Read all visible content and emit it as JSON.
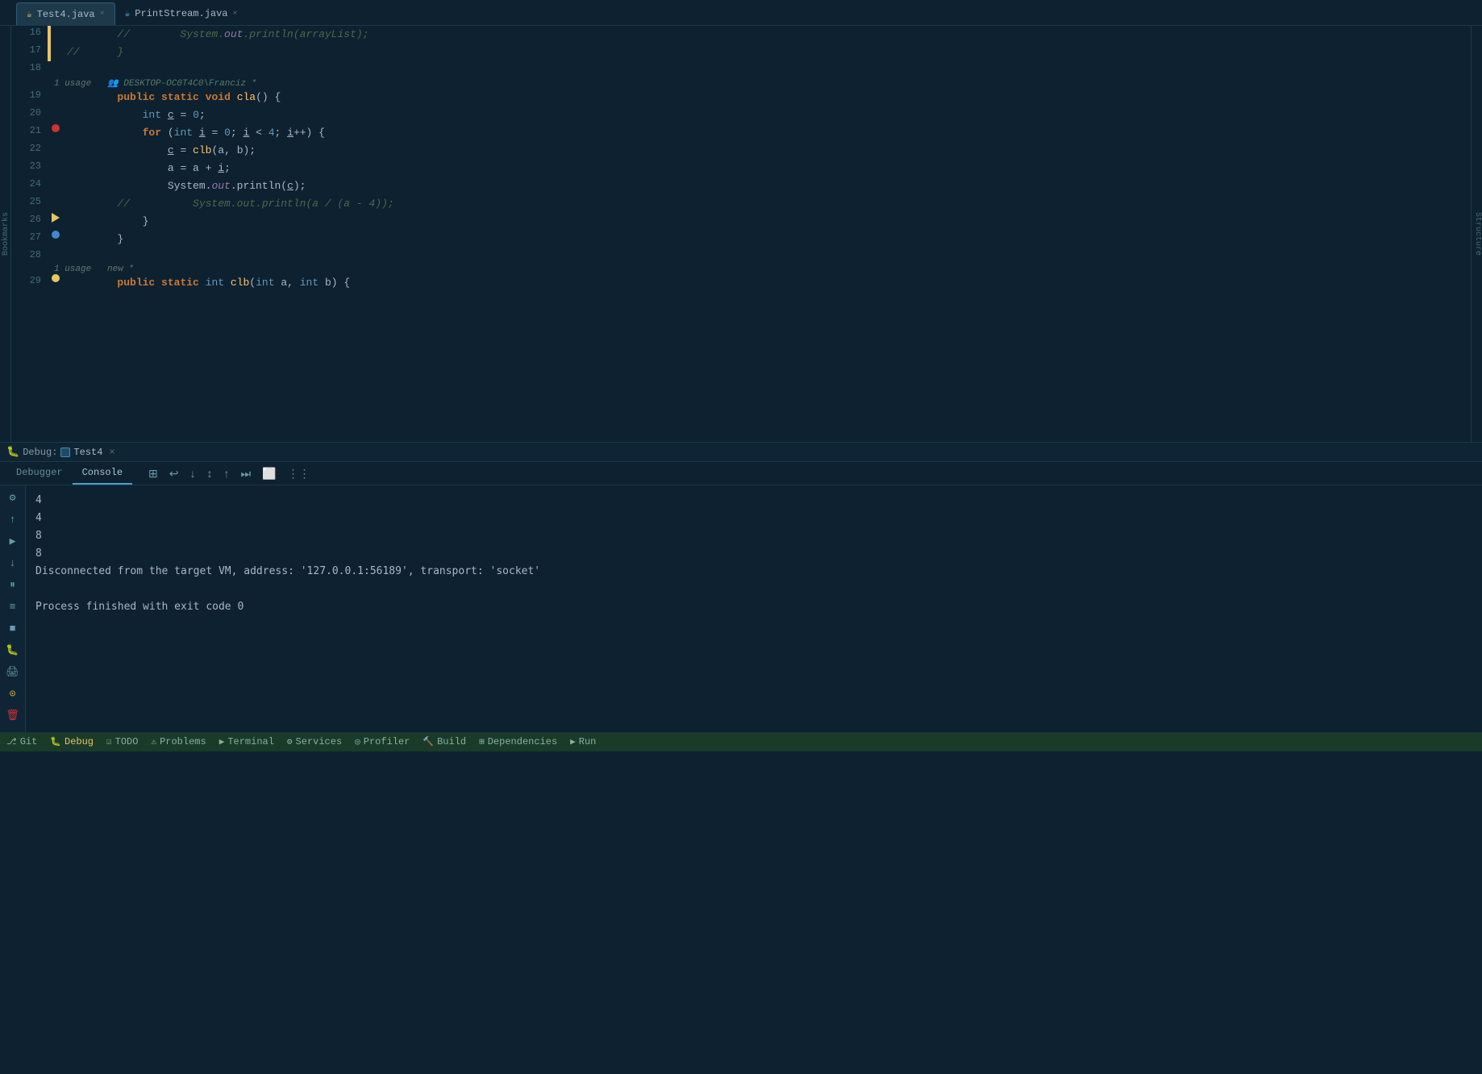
{
  "tabs": [
    {
      "id": "test4",
      "label": "Test4.java",
      "icon": "☕",
      "active": true
    },
    {
      "id": "printstream",
      "label": "PrintStream.java",
      "icon": "☕",
      "active": false
    }
  ],
  "code_lines": [
    {
      "num": 16,
      "content": "        //        System.out.println(arrayList);",
      "has_yellow_bar": true,
      "type": "comment_indent"
    },
    {
      "num": 17,
      "content": "//      }",
      "has_yellow_bar": true,
      "type": "comment_indent"
    },
    {
      "num": 18,
      "content": "",
      "has_yellow_bar": false
    },
    {
      "num": 19,
      "content": "        public static void cla() {",
      "has_yellow_bar": false,
      "usage": "1 usage  👥 DESKTOP-OC0T4C0\\Franciz *"
    },
    {
      "num": 20,
      "content": "            int c = 0;",
      "has_yellow_bar": false
    },
    {
      "num": 21,
      "content": "            for (int i = 0; i < 4; i++) {",
      "has_yellow_bar": false,
      "has_breakpoint": true
    },
    {
      "num": 22,
      "content": "                c = clb(a, b);",
      "has_yellow_bar": false
    },
    {
      "num": 23,
      "content": "                a = a + i;",
      "has_yellow_bar": false
    },
    {
      "num": 24,
      "content": "                System.out.println(c);",
      "has_yellow_bar": false
    },
    {
      "num": 25,
      "content": "        //          System.out.println(a / (a - 4));",
      "has_yellow_bar": false,
      "type": "comment"
    },
    {
      "num": 26,
      "content": "            }",
      "has_yellow_bar": false,
      "has_red_arrow": true
    },
    {
      "num": 27,
      "content": "        }",
      "has_yellow_bar": false,
      "has_breakpoint_blue": true
    },
    {
      "num": 28,
      "content": ""
    },
    {
      "num": 29,
      "content": "        public static int clb(int a, int b) {",
      "has_yellow_bar": false,
      "usage": "1 usage  new *",
      "has_breakpoint_yellow": true
    }
  ],
  "debug_header": {
    "label": "Debug:",
    "run_config": "Test4",
    "close": "×"
  },
  "debug_tabs": [
    {
      "id": "debugger",
      "label": "Debugger",
      "active": false
    },
    {
      "id": "console",
      "label": "Console",
      "active": true
    }
  ],
  "debug_toolbar_buttons": [
    {
      "id": "layout",
      "icon": "⊞"
    },
    {
      "id": "step-over",
      "icon": "↩"
    },
    {
      "id": "step-into",
      "icon": "↓"
    },
    {
      "id": "step-out",
      "icon": "↕"
    },
    {
      "id": "step-up",
      "icon": "↑"
    },
    {
      "id": "run-cursor",
      "icon": "⏭"
    },
    {
      "id": "eval",
      "icon": "⬜"
    },
    {
      "id": "customize",
      "icon": "⋮⋮"
    }
  ],
  "console_output": [
    {
      "id": "line1",
      "text": "4"
    },
    {
      "id": "line2",
      "text": "4"
    },
    {
      "id": "line3",
      "text": "8"
    },
    {
      "id": "line4",
      "text": "8"
    },
    {
      "id": "line5",
      "text": "Disconnected from the target VM, address: '127.0.0.1:56189', transport: 'socket'"
    },
    {
      "id": "line6",
      "text": ""
    },
    {
      "id": "line7",
      "text": "Process finished with exit code 0"
    }
  ],
  "debug_side_icons": [
    {
      "id": "settings",
      "icon": "⚙",
      "color": "normal"
    },
    {
      "id": "up",
      "icon": "↑",
      "color": "normal"
    },
    {
      "id": "play",
      "icon": "▶",
      "color": "normal"
    },
    {
      "id": "down",
      "icon": "↓",
      "color": "normal"
    },
    {
      "id": "pause",
      "icon": "⏸",
      "color": "normal"
    },
    {
      "id": "wrap",
      "icon": "≡",
      "color": "normal"
    },
    {
      "id": "stop-square",
      "icon": "■",
      "color": "normal"
    },
    {
      "id": "debug-icon",
      "icon": "🐛",
      "color": "red"
    },
    {
      "id": "print",
      "icon": "🖨",
      "color": "normal"
    },
    {
      "id": "circle-stop",
      "icon": "⊙",
      "color": "yellow"
    },
    {
      "id": "trash",
      "icon": "🗑",
      "color": "red"
    },
    {
      "id": "more",
      "icon": "···",
      "color": "normal"
    }
  ],
  "status_bar": {
    "items": [
      {
        "id": "git",
        "icon": "⎇",
        "label": "Git"
      },
      {
        "id": "debug",
        "icon": "🐛",
        "label": "Debug",
        "active": true
      },
      {
        "id": "todo",
        "icon": "☑",
        "label": "TODO"
      },
      {
        "id": "problems",
        "icon": "⚠",
        "label": "Problems"
      },
      {
        "id": "terminal",
        "icon": "▶",
        "label": "Terminal"
      },
      {
        "id": "services",
        "icon": "⚙",
        "label": "Services"
      },
      {
        "id": "profiler",
        "icon": "◎",
        "label": "Profiler"
      },
      {
        "id": "build",
        "icon": "🔨",
        "label": "Build"
      },
      {
        "id": "dependencies",
        "icon": "⊞",
        "label": "Dependencies"
      },
      {
        "id": "run",
        "icon": "▶",
        "label": "Run"
      }
    ]
  }
}
